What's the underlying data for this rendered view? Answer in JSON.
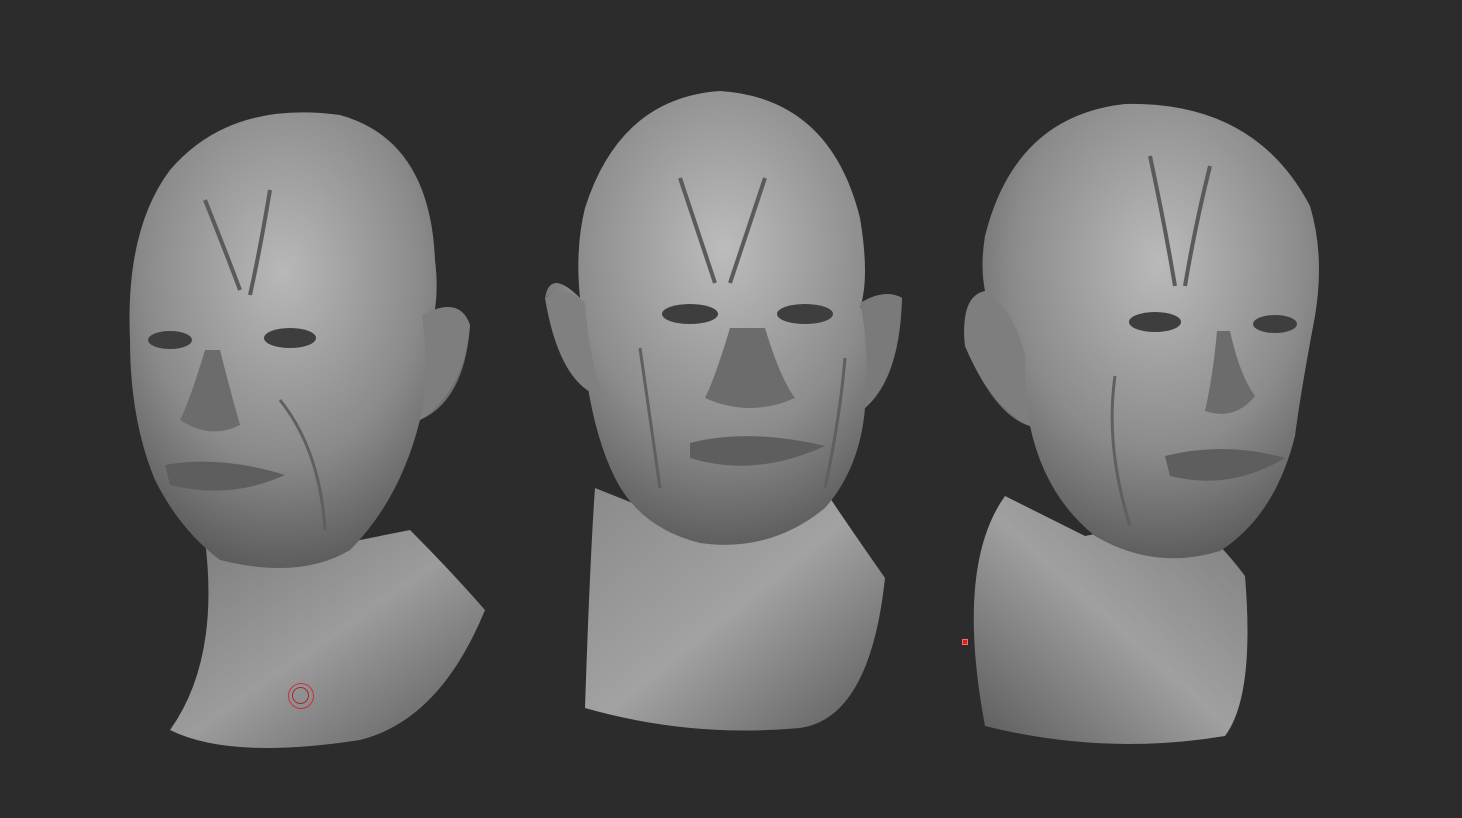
{
  "viewport": {
    "background_color": "#2c2c2c",
    "model_color": "#8e8e8e",
    "views": [
      {
        "name": "three-quarter-left"
      },
      {
        "name": "front"
      },
      {
        "name": "three-quarter-right"
      }
    ]
  },
  "cursor": {
    "icon": "brush-circle-icon",
    "color": "#c8323a"
  },
  "marker": {
    "icon": "red-square-marker-icon",
    "color": "#d0202a"
  }
}
